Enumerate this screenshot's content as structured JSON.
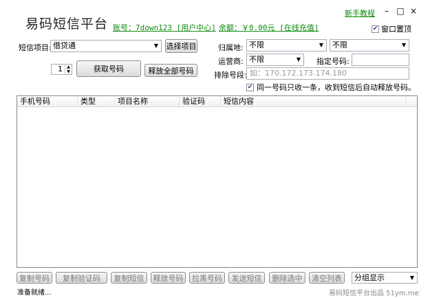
{
  "app_title": "易码短信平台",
  "account": "账号：7down123 [用户中心]",
  "balance": "余额：￥0.00元 [在线充值]",
  "help_link": "新手教程",
  "window_controls": {
    "minimize": "–",
    "restore": "□",
    "close": "×"
  },
  "top_checkbox": {
    "label": "窗口置顶",
    "checked": "✔"
  },
  "project": {
    "label": "短信项目:",
    "value": "借贷通",
    "button": "选择项目"
  },
  "count": {
    "value": "1",
    "up": "▲",
    "down": "▼"
  },
  "get_number_button": "获取号码",
  "release_all_button": "释放全部号码",
  "region": {
    "label": "归属地:",
    "value1": "不限",
    "value2": "不限"
  },
  "operator": {
    "label": "运营商:",
    "value": "不限"
  },
  "specify_number": {
    "label": "指定号码:",
    "value": ""
  },
  "exclude": {
    "label": "排除号段:",
    "placeholder": "如：170.172.173.174.180"
  },
  "receive_option": {
    "label": "同一号码只收一条，收到短信后自动释放号码。",
    "checked": "✔"
  },
  "table": {
    "columns": [
      "手机号码",
      "类型",
      "项目名称",
      "验证码",
      "短信内容"
    ]
  },
  "actions": [
    "复制号码",
    "复制验证码",
    "复制短信",
    "释放号码",
    "拉黑号码",
    "发送短信",
    "删除选中",
    "清空列表"
  ],
  "group_select": "分组显示",
  "status_text": "准备就绪...",
  "footer_text": "易码短信平台出品   51ym.me",
  "icons": {
    "dropdown": "chevron-down-icon",
    "resize": "resize-grip-icon"
  }
}
